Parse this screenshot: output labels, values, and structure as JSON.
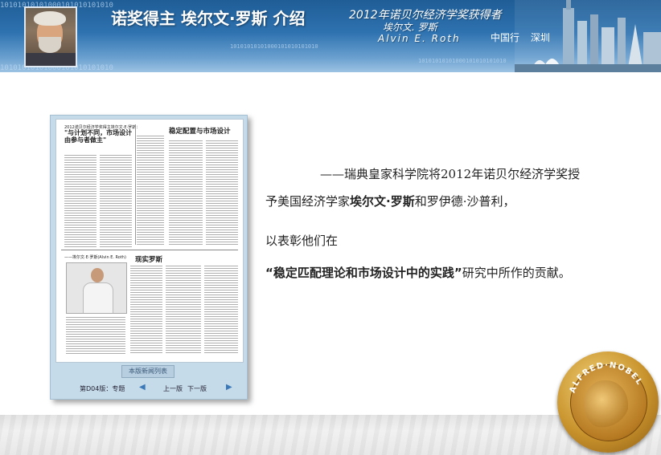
{
  "header": {
    "title": "诺奖得主 埃尔文·罗斯 介绍",
    "banner_line1": "2012年诺贝尔经济学奖获得者",
    "banner_line2": "埃尔文. 罗斯",
    "banner_line3": "Alvin E. Roth",
    "banner_location": "中国行 深圳",
    "binary_strip": "10101010101000101010101010"
  },
  "newspaper": {
    "kicker": "2012诺贝尔经济学奖得主埃尔文·E·罗斯：",
    "headline1": "\"与计划不同，市场设计由参与者做主\"",
    "headline2": "稳定配置与市场设计",
    "caption": "——埃尔文·E·罗斯(Alvin E. Roth)",
    "headline3": "现实罗斯",
    "list_button": "本版新闻列表",
    "edition_label": "第D04版：专题",
    "prev_label": "上一版",
    "next_label": "下一版",
    "prev_arrow": "◀",
    "next_arrow": "▶"
  },
  "body": {
    "line1": "——瑞典皇家科学院将2012年诺贝尔经济学奖授",
    "line2_pre": "予美国经济学家",
    "line2_bold": "埃尔文·罗斯",
    "line2_post": "和罗伊德·沙普利，",
    "line3": "以表彰他们在",
    "line4_bold": "“稳定匹配理论和市场设计中的实践”",
    "line4_post": "研究中所作的贡献。"
  },
  "medal": {
    "inscription": "ALFRED·NOBEL"
  },
  "colors": {
    "banner_blue": "#2e72b0",
    "paper_frame": "#c6dbe9",
    "medal_gold": "#c8932c"
  }
}
